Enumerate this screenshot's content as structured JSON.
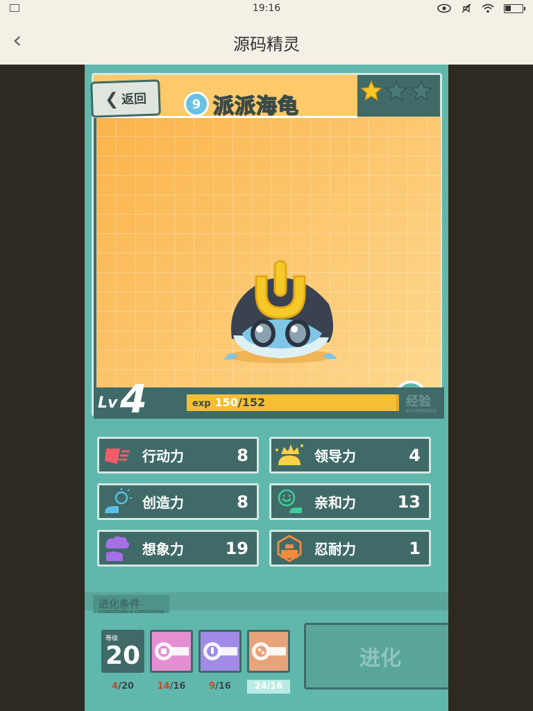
{
  "status_bar": {
    "time": "19:16"
  },
  "header": {
    "title": "源码精灵"
  },
  "card": {
    "back_label": "返回",
    "creature_level_badge": "9",
    "creature_name": "派派海龟",
    "stars_filled": 1,
    "stars_total": 3
  },
  "level": {
    "lv_label": "Lv",
    "value": "4",
    "exp_word": "exp",
    "exp_current": "150",
    "exp_max": "/152",
    "exp_fraction": 0.987,
    "caption": "经验",
    "caption_sub": "EXPERIENCE"
  },
  "stats": [
    {
      "label": "行动力",
      "value": "8",
      "icon": "action-icon",
      "color": "#f25c6b"
    },
    {
      "label": "领导力",
      "value": "4",
      "icon": "leadership-icon",
      "color": "#fbd04a"
    },
    {
      "label": "创造力",
      "value": "8",
      "icon": "creativity-icon",
      "color": "#5cc0e6"
    },
    {
      "label": "亲和力",
      "value": "13",
      "icon": "affinity-icon",
      "color": "#3fcf9a"
    },
    {
      "label": "想象力",
      "value": "19",
      "icon": "imagination-icon",
      "color": "#a56fe6"
    },
    {
      "label": "忍耐力",
      "value": "1",
      "icon": "endurance-icon",
      "color": "#f28a3f"
    }
  ],
  "evolution": {
    "title": "进化条件",
    "title_sub": "CONDITIONS & CONDITIONS",
    "level_small": "等级",
    "level_required": "20",
    "items": [
      {
        "have": "4",
        "need": "/20",
        "type": "level"
      },
      {
        "have": "14",
        "need": "/16",
        "type": "pink-key",
        "color": "#e58fd3"
      },
      {
        "have": "9",
        "need": "/16",
        "type": "purple-key",
        "color": "#a18be6"
      },
      {
        "have": "24",
        "need": "/16",
        "type": "orange-key",
        "color": "#e8a37a"
      }
    ],
    "button_label": "进化"
  }
}
